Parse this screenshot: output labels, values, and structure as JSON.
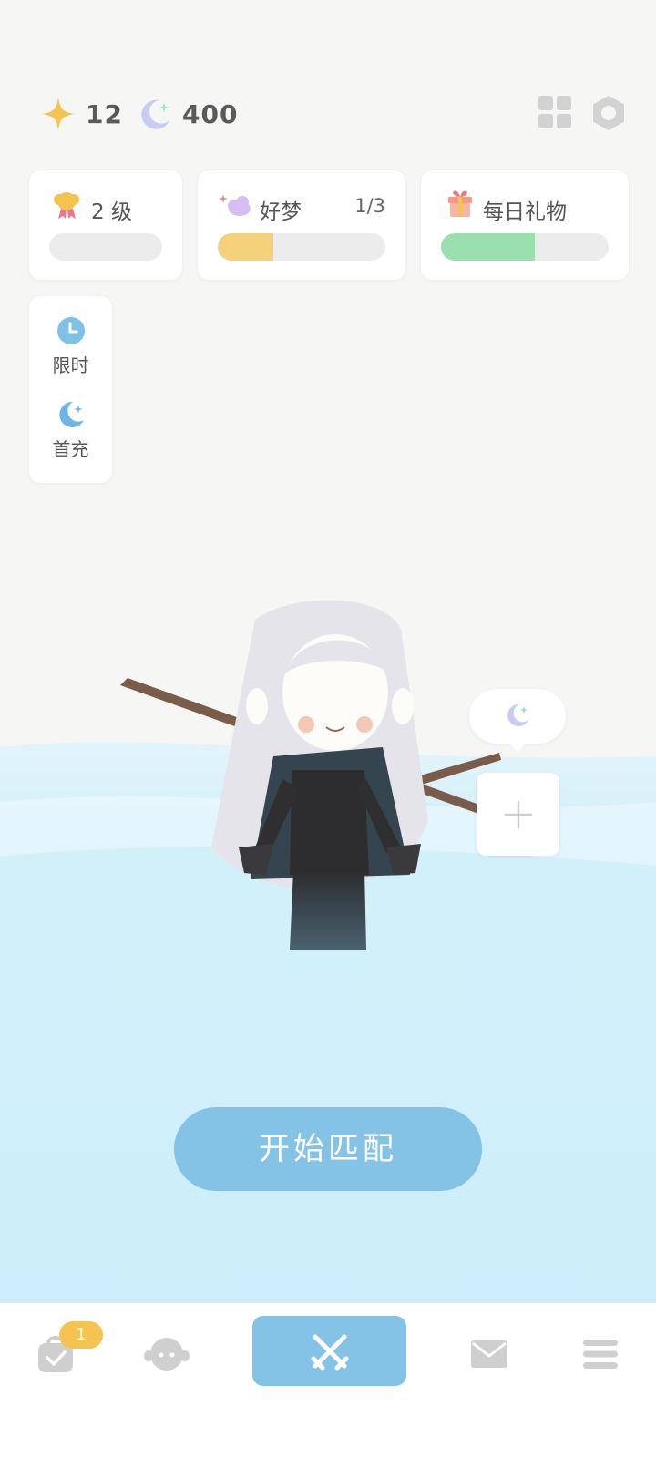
{
  "header": {
    "stars": "12",
    "moons": "400",
    "icons": [
      "grid-icon",
      "settings-icon"
    ]
  },
  "cards": {
    "level": {
      "label": "2 级",
      "progress": 0
    },
    "dream": {
      "label": "好梦",
      "count": "1/3",
      "progress": 0.33
    },
    "gift": {
      "label": "每日礼物",
      "progress": 0.56
    }
  },
  "side": {
    "limited": "限时",
    "first_charge": "首充"
  },
  "start_button": "开始匹配",
  "bottom_nav": {
    "badge": "1",
    "items": [
      "tasks-icon",
      "character-icon",
      "battle-icon",
      "mail-icon",
      "menu-icon"
    ]
  },
  "colors": {
    "accent": "#84c3e6",
    "gold": "#f5c34f",
    "dream_fill": "#f5d27a",
    "gift_fill": "#9ae0ae"
  }
}
